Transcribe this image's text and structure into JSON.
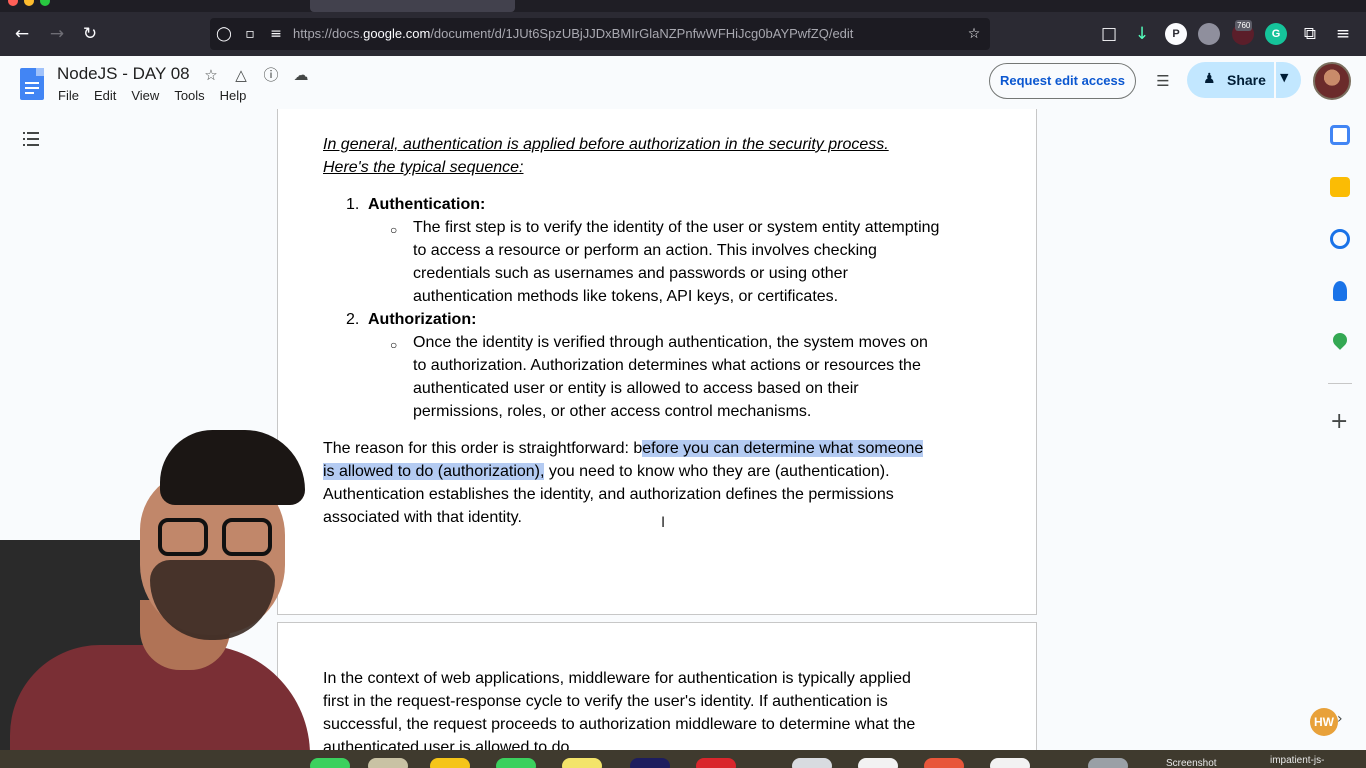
{
  "browser": {
    "url_prefix": "https://docs.",
    "url_domain": "google.com",
    "url_path": "/document/d/1JUt6SpzUBjJJDxBMIrGlaNZPnfwWFHiJcg0bAYPwfZQ/edit",
    "extension_badge": "760"
  },
  "docs": {
    "title": "NodeJS - DAY 08",
    "menu": [
      "File",
      "Edit",
      "View",
      "Tools",
      "Help"
    ],
    "request_edit_label": "Request edit access",
    "share_label": "Share"
  },
  "document": {
    "intro_line1": "In general, authentication is applied before authorization in the security process.",
    "intro_line2": "Here's the typical sequence:",
    "steps": [
      {
        "num": "1.",
        "label": "Authentication:",
        "lines": [
          "The first step is to verify the identity of the user or system entity attempting",
          "to access a resource or perform an action. This involves checking",
          "credentials such as usernames and passwords or using other",
          "authentication methods like tokens, API keys, or certificates."
        ]
      },
      {
        "num": "2.",
        "label": "Authorization:",
        "lines": [
          "Once the identity is verified through authentication, the system moves on",
          "to authorization. Authorization determines what actions or resources the",
          "authenticated user or entity is allowed to access based on their",
          "permissions, roles, or other access control mechanisms."
        ]
      }
    ],
    "reason": {
      "l1_plain": "The reason for this order is straightforward: b",
      "l1_highlight": "efore you can determine what someone",
      "l2_highlight": "is allowed to do (authorization),",
      "l2_plain": " you need to know who they are (authentication).",
      "l3": "Authentication establishes the identity, and authorization defines the permissions",
      "l4": "associated with that identity."
    },
    "page2": {
      "l1": "In the context of web applications, middleware for authentication is typically applied",
      "l2": "first in the request-response cycle to verify the user's identity. If authentication is",
      "l3": "successful, the request proceeds to authorization middleware to determine what the",
      "l4": "authenticated user is allowed to do."
    }
  },
  "side_panel": {
    "hw_badge": "HW"
  },
  "dock": {
    "labels": [
      "Screenshot",
      "impatient-js-"
    ]
  },
  "colors": {
    "highlight": "#b4cbf2",
    "share_bg": "#c2e7ff",
    "link_blue": "#0b57d0"
  }
}
